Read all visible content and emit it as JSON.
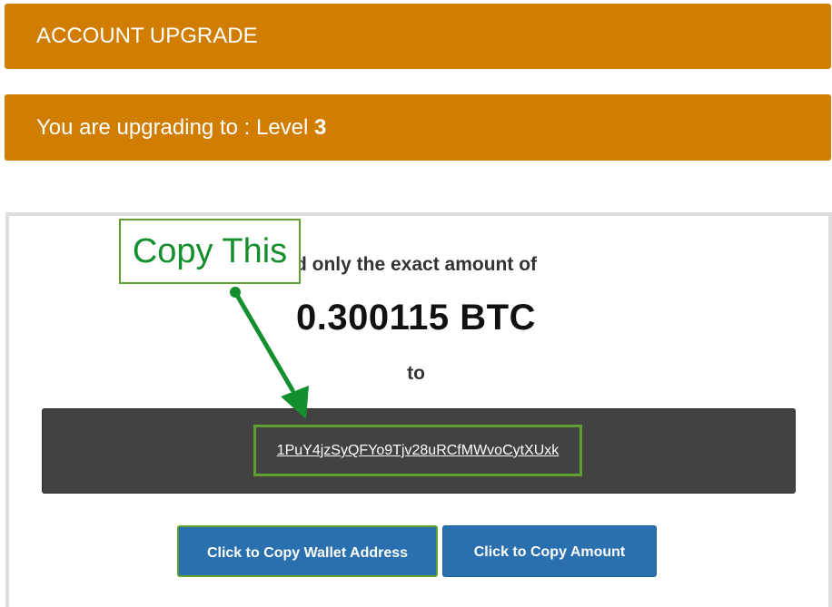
{
  "header": {
    "title": "ACCOUNT UPGRADE"
  },
  "upgrade": {
    "prefix": "You are upgrading to : Level",
    "level": "3"
  },
  "payment": {
    "instruction": "d only the exact amount of",
    "amount": "0.300115 BTC",
    "to_label": "to",
    "wallet_address": "1PuY4jzSyQFYo9Tjv28uRCfMWvoCytXUxk"
  },
  "annotation": {
    "label": "Copy This",
    "color": "#138f2d"
  },
  "buttons": {
    "copy_wallet": "Click to Copy Wallet Address",
    "copy_amount": "Click to Copy Amount"
  },
  "colors": {
    "accent": "#d07d00",
    "button": "#2a6fae",
    "wallet_box": "#424242",
    "highlight": "#5fa030"
  }
}
